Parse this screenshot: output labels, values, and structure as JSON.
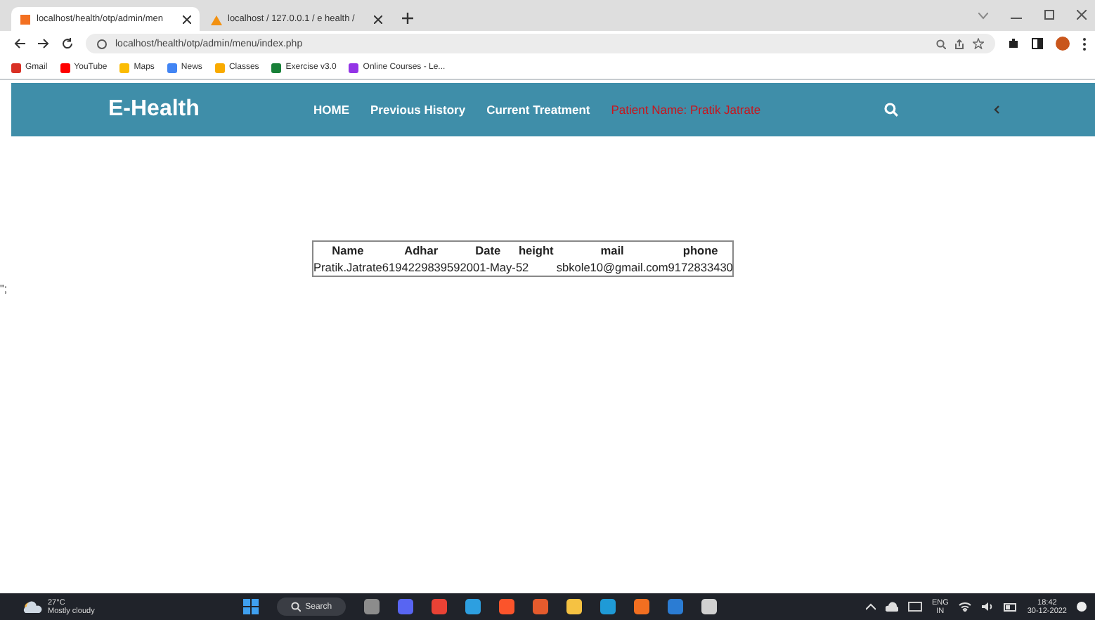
{
  "browser": {
    "tabs": [
      {
        "title": "localhost/health/otp/admin/men",
        "selected": true
      },
      {
        "title": "localhost / 127.0.0.1 / e health / ",
        "selected": false
      }
    ],
    "address": "localhost/health/otp/admin/menu/index.php",
    "bookmarks": [
      {
        "label": "Gmail",
        "color": "#d93025"
      },
      {
        "label": "YouTube",
        "color": "#ff0000"
      },
      {
        "label": "Maps",
        "color": "#fbbc04"
      },
      {
        "label": "News",
        "color": "#4285f4"
      },
      {
        "label": "Classes",
        "color": "#f9ab00"
      },
      {
        "label": "Exercise v3.0",
        "color": "#188038"
      },
      {
        "label": "Online Courses - Le...",
        "color": "#9334e6"
      }
    ]
  },
  "navbar": {
    "brand": "E-Health",
    "links": [
      {
        "label": "HOME",
        "kind": "link"
      },
      {
        "label": "Previous History",
        "kind": "link"
      },
      {
        "label": "Current Treatment",
        "kind": "link"
      },
      {
        "label": "Patient Name: Pratik Jatrate",
        "kind": "patient"
      }
    ]
  },
  "table": {
    "columns": [
      "Name",
      "Adhar",
      "Date",
      "height",
      "mail",
      "phone"
    ],
    "rows": [
      [
        "Pratik.Jatrate",
        "619422983959",
        "2001-May-",
        "52",
        "sbkole10@gmail.com",
        "9172833430"
      ]
    ]
  },
  "stray_text": "\";",
  "taskbar": {
    "temperature": "27°C",
    "weather": "Mostly cloudy",
    "search": "Search",
    "language": "ENG",
    "region": "IN",
    "time": "18:42",
    "date": "30-12-2022"
  }
}
